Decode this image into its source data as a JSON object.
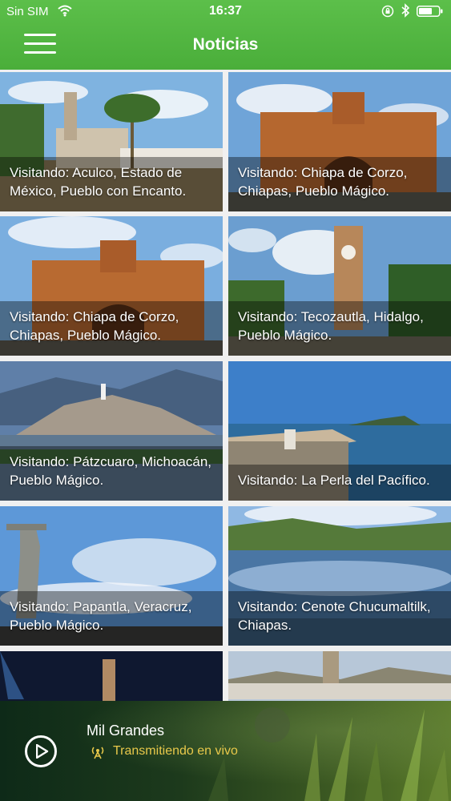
{
  "status_bar": {
    "carrier": "Sin SIM",
    "time": "16:37"
  },
  "header": {
    "title": "Noticias",
    "menu_icon": "hamburger-menu-icon"
  },
  "news": [
    {
      "title": "Visitando: Aculco, Estado de México, Pueblo con Encanto."
    },
    {
      "title": "Visitando: Chiapa de Corzo, Chiapas, Pueblo Mágico."
    },
    {
      "title": "Visitando: Chiapa de Corzo, Chiapas, Pueblo Mágico."
    },
    {
      "title": "Visitando: Tecozautla, Hidalgo, Pueblo Mágico."
    },
    {
      "title": "Visitando: Pátzcuaro, Michoacán, Pueblo Mágico."
    },
    {
      "title": "Visitando: La Perla del Pacífico."
    },
    {
      "title": "Visitando: Papantla, Veracruz, Pueblo Mágico."
    },
    {
      "title": "Visitando: Cenote Chucumaltilk, Chiapas."
    },
    {
      "title": ""
    },
    {
      "title": ""
    }
  ],
  "player": {
    "station": "Mil Grandes",
    "status": "Transmitiendo en vivo",
    "play_icon": "play-icon",
    "live_icon": "radio-tower-icon",
    "status_color": "#e8c84a"
  },
  "colors": {
    "header": "#52b642",
    "caption_text": "#ffffff"
  }
}
